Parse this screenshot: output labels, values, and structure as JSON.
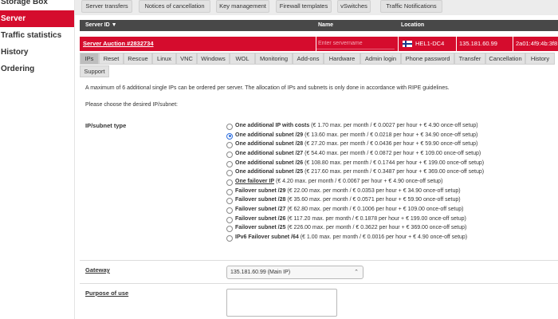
{
  "sidebar": {
    "items": [
      {
        "label": "Storage Box"
      },
      {
        "label": "Server"
      },
      {
        "label": "Traffic statistics"
      },
      {
        "label": "History"
      },
      {
        "label": "Ordering"
      }
    ]
  },
  "top_buttons": [
    {
      "label": "Server transfers"
    },
    {
      "label": "Notices of cancellation"
    },
    {
      "label": "Key management"
    },
    {
      "label": "Firewall templates"
    },
    {
      "label": "vSwitches"
    },
    {
      "label": "Traffic Notifications"
    }
  ],
  "table_header": {
    "server_id": "Server ID ▼",
    "name": "Name",
    "location": "Location"
  },
  "server_row": {
    "server_label": "Server Auction #2832734",
    "name_placeholder": "Enter servername",
    "datacenter": "HEL1-DC4",
    "ipv4": "135.181.60.99",
    "ipv6": "2a01:4f9:4b:3f8"
  },
  "tabs": [
    {
      "label": "IPs"
    },
    {
      "label": "Reset"
    },
    {
      "label": "Rescue"
    },
    {
      "label": "Linux"
    },
    {
      "label": "VNC"
    },
    {
      "label": "Windows"
    },
    {
      "label": "WOL"
    },
    {
      "label": "Monitoring"
    },
    {
      "label": "Add-ons"
    },
    {
      "label": "Hardware"
    },
    {
      "label": "Admin login"
    },
    {
      "label": "Phone password"
    },
    {
      "label": "Transfer"
    },
    {
      "label": "Cancellation"
    },
    {
      "label": "History"
    },
    {
      "label": "Support"
    }
  ],
  "intro": {
    "line1": "A maximum of 6 additional single IPs can be ordered per server. The allocation of IPs and subnets is only done in accordance with RIPE guidelines.",
    "line2": "Please choose the desired IP/subnet:"
  },
  "subnet": {
    "label": "IP/subnet type",
    "options": [
      {
        "name": "One additional IP with costs",
        "price": " (€ 1.70 max. per month / € 0.0027 per hour + € 4.90 once-off setup)",
        "selected": false
      },
      {
        "name": "One additional subnet /29",
        "price": " (€ 13.60 max. per month / € 0.0218 per hour + € 34.90 once-off setup)",
        "selected": true
      },
      {
        "name": "One additional subnet /28",
        "price": " (€ 27.20 max. per month / € 0.0436 per hour + € 59.90 once-off setup)",
        "selected": false
      },
      {
        "name": "One additional subnet /27",
        "price": " (€ 54.40 max. per month / € 0.0872 per hour + € 109.00 once-off setup)",
        "selected": false
      },
      {
        "name": "One additional subnet /26",
        "price": " (€ 108.80 max. per month / € 0.1744 per hour + € 199.00 once-off setup)",
        "selected": false
      },
      {
        "name": "One additional subnet /25",
        "price": " (€ 217.60 max. per month / € 0.3487 per hour + € 369.00 once-off setup)",
        "selected": false
      },
      {
        "name": "One failover IP",
        "price": " (€ 4.20 max. per month / € 0.0067 per hour + € 4.90 once-off setup)",
        "selected": false
      },
      {
        "name": "Failover subnet /29",
        "price": " (€ 22.00 max. per month / € 0.0353 per hour + € 34.90 once-off setup)",
        "selected": false
      },
      {
        "name": "Failover subnet /28",
        "price": " (€ 35.60 max. per month / € 0.0571 per hour + € 59.90 once-off setup)",
        "selected": false
      },
      {
        "name": "Failover subnet /27",
        "price": " (€ 62.80 max. per month / € 0.1006 per hour + € 109.00 once-off setup)",
        "selected": false
      },
      {
        "name": "Failover subnet /26",
        "price": " (€ 117.20 max. per month / € 0.1878 per hour + € 199.00 once-off setup)",
        "selected": false
      },
      {
        "name": "Failover subnet /25",
        "price": " (€ 226.00 max. per month / € 0.3622 per hour + € 369.00 once-off setup)",
        "selected": false
      },
      {
        "name": "IPv6 Failover subnet /64",
        "price": " (€ 1.00 max. per month / € 0.0016 per hour + € 4.90 once-off setup)",
        "selected": false
      }
    ]
  },
  "gateway": {
    "label": "Gateway",
    "selected": "135.181.60.99 (Main IP)"
  },
  "purpose": {
    "label": "Purpose of use"
  },
  "colors": {
    "accent": "#d50c2d",
    "header_bg": "#484848",
    "radio_selected": "#2f6fde"
  },
  "icons": {
    "flag": "finland-flag-icon",
    "sort": "sort-down-icon",
    "select": "chevron-down-icon"
  }
}
